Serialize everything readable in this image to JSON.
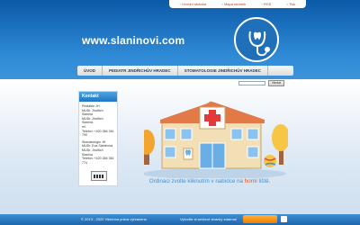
{
  "top_links": [
    "Úvodní stránka",
    "Mapa stránek",
    "RSS",
    "Tisk"
  ],
  "site": {
    "logo_text": "www.slaninovi.com"
  },
  "nav": {
    "items": [
      "ÚVOD",
      "PEDIATR JINDŘICHŮV HRADEC",
      "STOMATOLOGIE JINDŘICHŮV HRADEC"
    ]
  },
  "search": {
    "button_label": "Hledat"
  },
  "sidebar": {
    "title": "Kontakt",
    "block1": [
      "Pediatrie JH",
      "MUDr. Jindřich Slanina",
      "MUDr. Jindřich Slanina,",
      "ml.",
      "Telefon: +420 384 361",
      "790"
    ],
    "block2": [
      "Stomatologie JH",
      "MUDr. Eva Slaninová",
      "MUDr. Jindřich Slanina",
      "Telefon: +420 384 361",
      "774"
    ]
  },
  "caption": {
    "before": "Ordinaci zvolte kliknutím v nabídce na ",
    "highlight": "horní",
    "after": " liště."
  },
  "footer": {
    "copyright": "© 2013 - 2022 Všechna práva vyhrazena",
    "promo": "Vytvořte si webové stránky zdarma!"
  },
  "icons": [
    "stethoscope-tooth-icon",
    "search-icon",
    "clinic-illustration"
  ],
  "colors": {
    "header_blue": "#1f6fb9",
    "accent_orange": "#ec4b1e",
    "link_red": "#c0392b"
  }
}
